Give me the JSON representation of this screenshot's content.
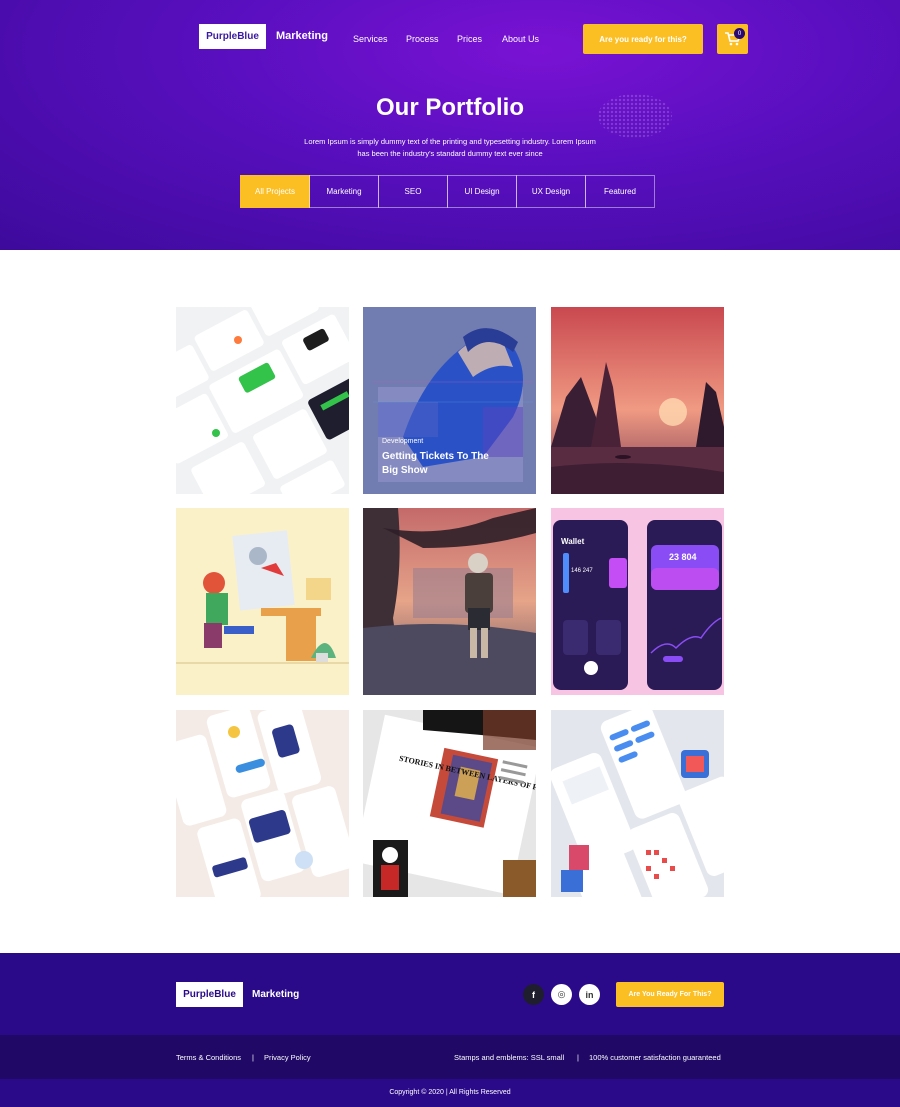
{
  "header": {
    "logo_box": "PurpleBlue",
    "logo_text": "Marketing",
    "nav": [
      "Services",
      "Process",
      "Prices",
      "About Us"
    ],
    "cta": "Are you ready for this?",
    "cart_count": "0",
    "cart_icon": "shopping-cart-icon"
  },
  "hero": {
    "title": "Our Portfolio",
    "subtitle": "Lorem Ipsum is simply dummy text of the printing and typesetting industry. Lorem Ipsum has been the industry's standard dummy text ever since"
  },
  "filters": {
    "items": [
      "All Projects",
      "Marketing",
      "SEO",
      "UI Design",
      "UX Design",
      "Featured"
    ],
    "active": "All Projects"
  },
  "portfolio": {
    "featured_card": {
      "category": "Development",
      "title": "Getting Tickets To The Big Show"
    },
    "items": [
      {
        "name": "dashboard-ui-mockup"
      },
      {
        "name": "hooded-figure-illustration"
      },
      {
        "name": "sunset-landscape-illustration"
      },
      {
        "name": "designer-at-desk-illustration"
      },
      {
        "name": "traveler-under-tree-illustration"
      },
      {
        "name": "wallet-app-mockup",
        "texts": [
          "Wallet",
          "146 247",
          "23 804"
        ]
      },
      {
        "name": "mobile-onboarding-mockup"
      },
      {
        "name": "magazine-layout-mockup",
        "texts": [
          "STORIES IN BETWEEN LAYERS OF PAINT"
        ]
      },
      {
        "name": "messaging-app-mockup"
      }
    ]
  },
  "footer": {
    "logo_box": "PurpleBlue",
    "logo_text": "Marketing",
    "social": [
      {
        "icon": "facebook-icon",
        "glyph": "f"
      },
      {
        "icon": "instagram-icon",
        "glyph": "◎"
      },
      {
        "icon": "linkedin-icon",
        "glyph": "in"
      }
    ],
    "cta": "Are You Ready For This?",
    "links": [
      "Terms & Conditions",
      "Privacy Policy"
    ],
    "stamps_label": "Stamps and emblems:  SSL small",
    "guarantee": "100% customer satisfaction guaranteed",
    "separator": "|",
    "copyright": "Copyright © 2020 | All Rights Reserved"
  },
  "colors": {
    "primary": "#4a0db0",
    "accent": "#fbbf24",
    "footer": "#2b0a8a",
    "footer_dark": "#1f0866"
  }
}
